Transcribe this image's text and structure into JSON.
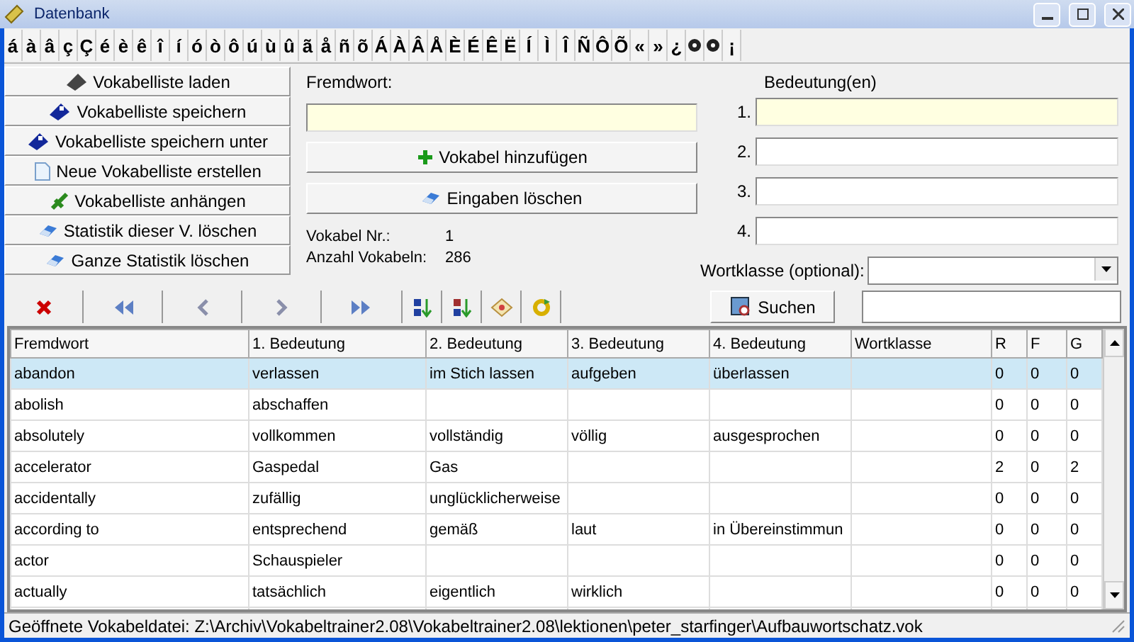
{
  "window": {
    "title": "Datenbank"
  },
  "char_bar": [
    "á",
    "à",
    "â",
    "ç",
    "Ç",
    "é",
    "è",
    "ê",
    "î",
    "í",
    "ó",
    "ò",
    "ô",
    "ú",
    "ù",
    "û",
    "ã",
    "å",
    "ñ",
    "õ",
    "Á",
    "À",
    "Â",
    "Å",
    "È",
    "É",
    "Ê",
    "Ë",
    "Í",
    "Ì",
    "Î",
    "Ñ",
    "Ô",
    "Õ",
    "«",
    "»",
    "¿",
    {
      "kind": "icon"
    },
    {
      "kind": "icon"
    },
    "¡"
  ],
  "sidebar": {
    "buttons": [
      {
        "label": "Vokabelliste laden",
        "kind": "load"
      },
      {
        "label": "Vokabelliste speichern",
        "kind": "save"
      },
      {
        "label": "Vokabelliste speichern unter",
        "kind": "save"
      },
      {
        "label": "Neue Vokabelliste erstellen",
        "kind": "new"
      },
      {
        "label": "Vokabelliste anhängen",
        "kind": "append"
      },
      {
        "label": "Statistik dieser V. löschen",
        "kind": "erase"
      },
      {
        "label": "Ganze Statistik löschen",
        "kind": "erase"
      }
    ]
  },
  "entry": {
    "label": "Fremdwort:",
    "field": {
      "active": true
    },
    "add_button": "Vokabel hinzufügen",
    "clear_button": "Eingaben löschen",
    "info": [
      {
        "label": "Vokabel Nr.:",
        "value": "1"
      },
      {
        "label": "Anzahl Vokabeln:",
        "value": "286"
      }
    ]
  },
  "meanings": {
    "label": "Bedeutung(en)",
    "fields": [
      {
        "number": "1.",
        "active": true
      },
      {
        "number": "2.",
        "active": false
      },
      {
        "number": "3.",
        "active": false
      },
      {
        "number": "4.",
        "active": false
      }
    ]
  },
  "word_class": {
    "label": "Wortklasse (optional):"
  },
  "toolbar": [
    {
      "kind": "delete"
    },
    {
      "kind": "first"
    },
    {
      "kind": "previous"
    },
    {
      "kind": "next"
    },
    {
      "kind": "last"
    },
    {
      "kind": "sort-asc"
    },
    {
      "kind": "sort-desc"
    },
    {
      "kind": "shuffle"
    },
    {
      "kind": "refresh"
    }
  ],
  "search": {
    "button": "Suchen"
  },
  "table": {
    "columns": [
      "Fremdwort",
      "1. Bedeutung",
      "2. Bedeutung",
      "3. Bedeutung",
      "4. Bedeutung",
      "Wortklasse",
      "R",
      "F",
      "G"
    ],
    "rows": [
      {
        "selected": true,
        "cells": [
          "abandon",
          "verlassen",
          "im Stich lassen",
          "aufgeben",
          "überlassen",
          "",
          "0",
          "0",
          "0"
        ]
      },
      {
        "selected": false,
        "cells": [
          "abolish",
          "abschaffen",
          "",
          "",
          "",
          "",
          "0",
          "0",
          "0"
        ]
      },
      {
        "selected": false,
        "cells": [
          "absolutely",
          "vollkommen",
          "vollständig",
          "völlig",
          "ausgesprochen",
          "",
          "0",
          "0",
          "0"
        ]
      },
      {
        "selected": false,
        "cells": [
          "accelerator",
          "Gaspedal",
          "Gas",
          "",
          "",
          "",
          "2",
          "0",
          "2"
        ]
      },
      {
        "selected": false,
        "cells": [
          "accidentally",
          "zufällig",
          "unglücklicherweise",
          "",
          "",
          "",
          "0",
          "0",
          "0"
        ]
      },
      {
        "selected": false,
        "cells": [
          "according to",
          "entsprechend",
          "gemäß",
          "laut",
          "in Übereinstimmun",
          "",
          "0",
          "0",
          "0"
        ]
      },
      {
        "selected": false,
        "cells": [
          "actor",
          "Schauspieler",
          "",
          "",
          "",
          "",
          "0",
          "0",
          "0"
        ]
      },
      {
        "selected": false,
        "cells": [
          "actually",
          "tatsächlich",
          "eigentlich",
          "wirklich",
          "",
          "",
          "0",
          "0",
          "0"
        ]
      }
    ]
  },
  "status_bar": {
    "text": "Geöffnete Vokabeldatei: Z:\\Archiv\\Vokabeltrainer2.08\\Vokabeltrainer2.08\\lektionen\\peter_starfinger\\Aufbauwortschatz.vok"
  }
}
